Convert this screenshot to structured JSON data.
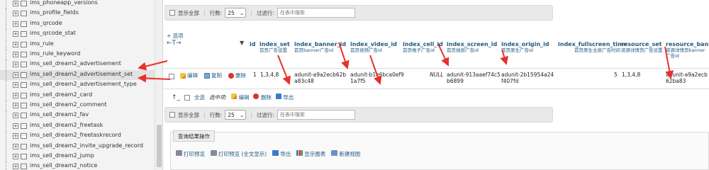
{
  "sidebar": {
    "items": [
      {
        "label": "ims_phoneapp_versions",
        "active": false
      },
      {
        "label": "ims_profile_fields",
        "active": false
      },
      {
        "label": "ims_qrcode",
        "active": false
      },
      {
        "label": "ims_qrcode_stat",
        "active": false
      },
      {
        "label": "ims_rule",
        "active": false
      },
      {
        "label": "ims_rule_keyword",
        "active": false
      },
      {
        "label": "ims_sell_dream2_advertisement",
        "active": false
      },
      {
        "label": "ims_sell_dream2_advertisement_set",
        "active": true
      },
      {
        "label": "ims_sell_dream2_advertisement_type",
        "active": false
      },
      {
        "label": "ims_sell_dream2_card",
        "active": false
      },
      {
        "label": "ims_sell_dream2_comment",
        "active": false
      },
      {
        "label": "ims_sell_dream2_fav",
        "active": false
      },
      {
        "label": "ims_sell_dream2_freetask",
        "active": false
      },
      {
        "label": "ims_sell_dream2_freetaskrecord",
        "active": false
      },
      {
        "label": "ims_sell_dream2_invite_upgrade_record",
        "active": false
      },
      {
        "label": "ims_sell_dream2_jump",
        "active": false
      },
      {
        "label": "ims_sell_dream2_notice",
        "active": false
      }
    ],
    "expand_glyph": "+"
  },
  "nav_top": {
    "show_all": "显示全部",
    "rows_label": "行数:",
    "rows_value": "25",
    "filter_label": "过滤行:",
    "filter_placeholder": "在表中搜索"
  },
  "nav_bottom": {
    "show_all": "显示全部",
    "rows_label": "行数:",
    "rows_value": "25",
    "filter_label": "过滤行:",
    "filter_placeholder": "在表中搜索"
  },
  "options_link": "+ 选项",
  "col_arrows": "←T→",
  "sort_arrow": "▼",
  "columns": [
    {
      "name": "id",
      "comment": ""
    },
    {
      "name": "index_set",
      "comment": "首页广告设置"
    },
    {
      "name": "index_banner_id",
      "comment": "首页banner广告id"
    },
    {
      "name": "index_video_id",
      "comment": "首页视频广告id"
    },
    {
      "name": "index_cell_id",
      "comment": "首页格子广告id"
    },
    {
      "name": "index_screen_id",
      "comment": "首页插屏广告id"
    },
    {
      "name": "index_origin_id",
      "comment": "首页原生广告id"
    },
    {
      "name": "index_fullscreen_time",
      "comment": "首页原生全屏广告时间"
    },
    {
      "name": "resource_set",
      "comment": "资源详情页广告设置"
    },
    {
      "name": "resource_banne",
      "comment": "资源详情页banner广告id"
    }
  ],
  "row": {
    "edit": "编辑",
    "copy": "复制",
    "delete": "删除",
    "id": "1",
    "index_set": "1,3,4,8",
    "index_banner_id": "adunit-a9a2ecb62ba83c48",
    "index_video_id": "adunit-b1e6bca0ef91a7f5",
    "index_cell_id": "NULL",
    "index_screen_id": "adunit-913aaef74c5b6899",
    "index_origin_id": "adunit-2b15954a24f407fd",
    "index_fullscreen_time": "5",
    "resource_set": "1,3,4,8",
    "resource_banne": "adunit-a9a2ecb62ba83"
  },
  "bulk": {
    "select_all": "全选",
    "selected_label": "选中项:",
    "edit": "编辑",
    "delete": "删除",
    "export": "导出"
  },
  "results": {
    "legend": "查询结果操作",
    "print": "打印预览",
    "print_full": "打印预览 (全文显示)",
    "export": "导出",
    "chart": "显示图表",
    "create_view": "新建视图"
  },
  "colors": {
    "link": "#235a81",
    "annotation": "#e8302c"
  }
}
